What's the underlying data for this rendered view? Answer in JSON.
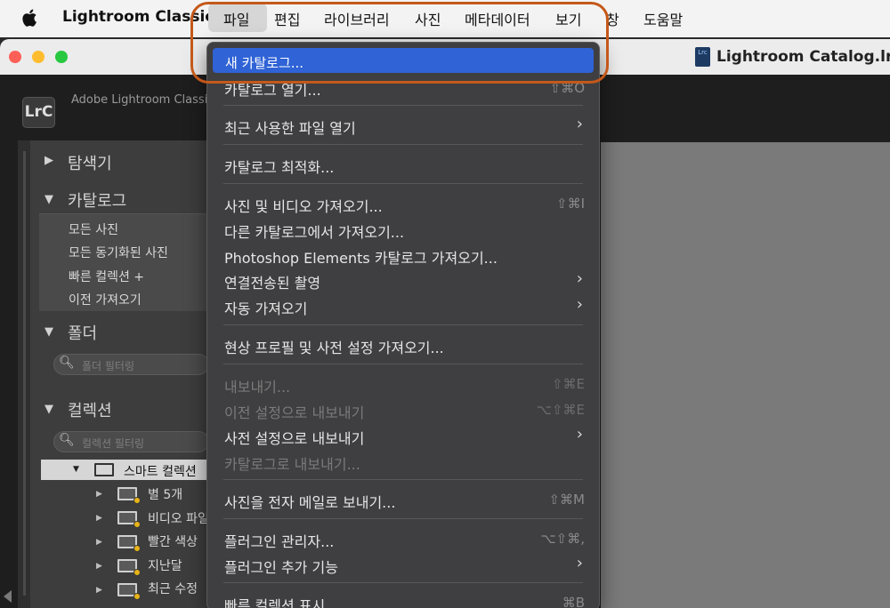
{
  "menubar": {
    "app_name": "Lightroom Classic",
    "items": [
      "파일",
      "편집",
      "라이브러리",
      "사진",
      "메타데이터",
      "보기",
      "창",
      "도움말"
    ]
  },
  "window": {
    "doc_icon_text": "Lrc",
    "doc_title": "Lightroom Catalog.lrca"
  },
  "app": {
    "logo": "LrC",
    "title": "Adobe Lightroom Classic"
  },
  "left_panel": {
    "navigator": "탐색기",
    "catalog": "카탈로그",
    "catalog_items": [
      "모든 사진",
      "모든 동기화된 사진",
      "빠른 컬렉션 +",
      "이전 가져오기"
    ],
    "folders": "폴더",
    "folders_search_placeholder": "폴더 필터링",
    "collections": "컬렉션",
    "collections_search_placeholder": "컬렉션 필터링",
    "smart_collection": "스마트 컬렉션",
    "smart_items": [
      "별 5개",
      "비디오 파일",
      "빨간 색상",
      "지난달",
      "최근 수정"
    ]
  },
  "dropdown": {
    "highlighted": "새 카탈로그...",
    "open_catalog": "카탈로그 열기...",
    "open_catalog_shortcut": "⇧⌘O",
    "open_recent": "최근 사용한 파일 열기",
    "optimize": "카탈로그 최적화...",
    "import_photos": "사진 및 비디오 가져오기...",
    "import_photos_shortcut": "⇧⌘I",
    "import_from_catalog": "다른 카탈로그에서 가져오기...",
    "import_elements": "Photoshop Elements 카탈로그 가져오기...",
    "tethered": "연결전송된 촬영",
    "auto_import": "자동 가져오기",
    "import_profiles": "현상 프로필 및 사전 설정 가져오기...",
    "export": "내보내기...",
    "export_shortcut": "⇧⌘E",
    "export_previous": "이전 설정으로 내보내기",
    "export_previous_shortcut": "⌥⇧⌘E",
    "export_preset": "사전 설정으로 내보내기",
    "export_catalog": "카탈로그로 내보내기...",
    "email": "사진을 전자 메일로 보내기...",
    "email_shortcut": "⇧⌘M",
    "plugin_manager": "플러그인 관리자...",
    "plugin_manager_shortcut": "⌥⇧⌘,",
    "plugin_extras": "플러그인 추가 기능",
    "show_quick": "빠른 컬렉션 표시",
    "show_quick_shortcut": "⌘B"
  },
  "colors": {
    "highlight": "#2f63d6",
    "annotation": "#c4581a"
  }
}
